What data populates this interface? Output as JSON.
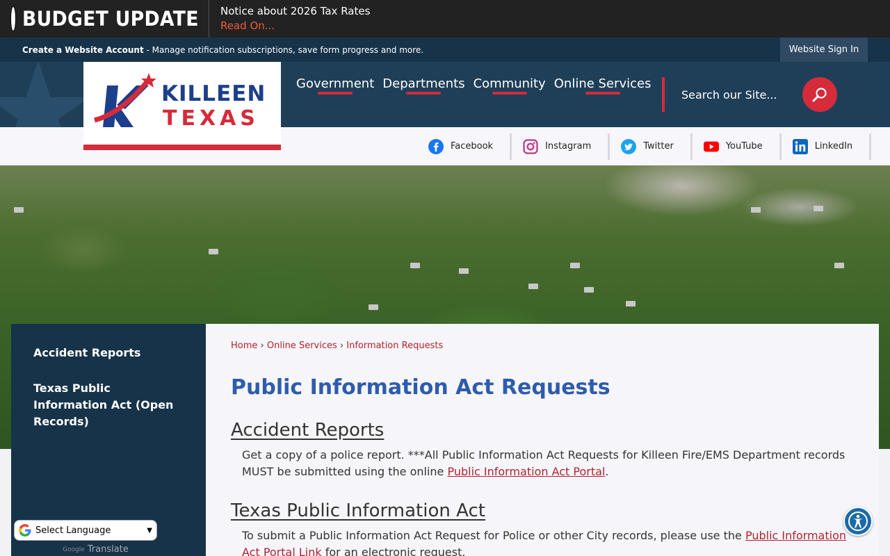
{
  "alert": {
    "title": "BUDGET UPDATE",
    "notice": "Notice about 2026 Tax Rates",
    "link": "Read On..."
  },
  "account": {
    "create_label": "Create a Website Account",
    "description": " - Manage notification subscriptions, save form progress and more.",
    "signin": "Website Sign In"
  },
  "logo": {
    "line1": "KILLEEN",
    "line2": "TEXAS"
  },
  "nav": {
    "items": [
      "Government",
      "Departments",
      "Community",
      "Online Services"
    ]
  },
  "search": {
    "placeholder": "Search our Site..."
  },
  "social": {
    "items": [
      "Facebook",
      "Instagram",
      "Twitter",
      "YouTube",
      "LinkedIn"
    ]
  },
  "sidebar": {
    "items": [
      "Accident Reports",
      "Texas Public Information Act (Open Records)"
    ]
  },
  "breadcrumb": {
    "home": "Home",
    "sep": "›",
    "online_services": "Online Services",
    "current": "Information Requests"
  },
  "main": {
    "title": "Public Information Act Requests",
    "sections": [
      {
        "title": "Accident Reports",
        "text_before": "Get a copy of a police report. ***All Public Information Act Requests for Killeen Fire/EMS Department records MUST be submitted using the online ",
        "link": "Public Information Act Portal",
        "text_after": "."
      },
      {
        "title": "Texas Public Information Act",
        "text_before": "To submit a Public Information Act Request for Police or other City records, please use the ",
        "link": "Public Information Act Portal Link",
        "text_after": " for an electronic request."
      }
    ]
  },
  "translate": {
    "label": "Select Language",
    "powered_by": "Google",
    "translate": "Translate"
  },
  "colors": {
    "brand_red": "#d52b3a",
    "navy": "#17334a",
    "title_blue": "#2e5cad"
  }
}
